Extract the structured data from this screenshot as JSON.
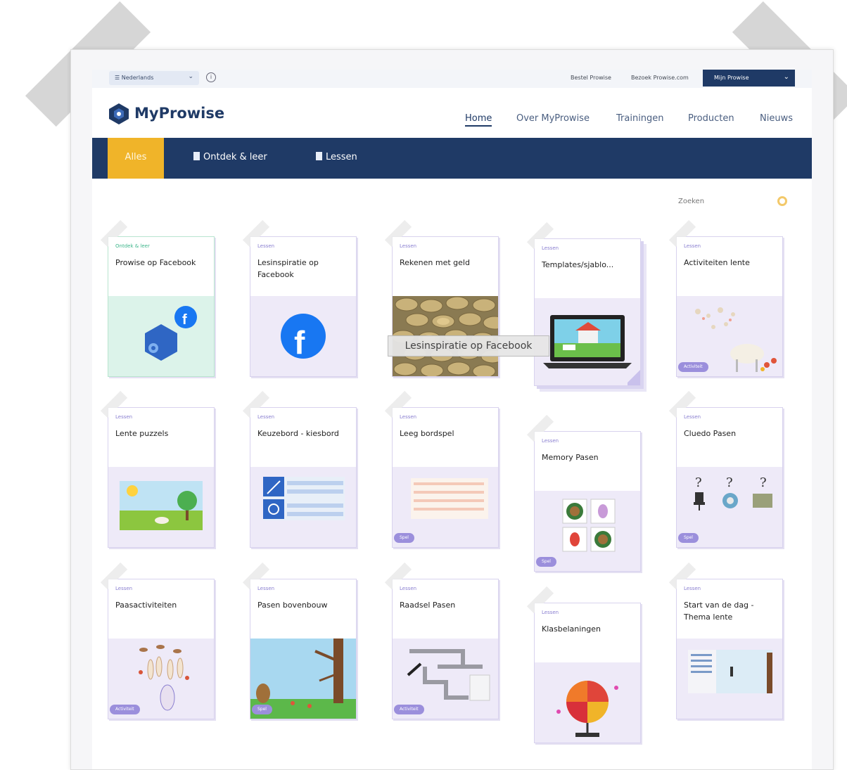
{
  "topbar": {
    "language": "Nederlands",
    "links": [
      "Bestel Prowise",
      "Bezoek Prowise.com"
    ],
    "account": "Mijn Prowise"
  },
  "brand": "MyProwise",
  "nav": [
    "Home",
    "Over MyProwise",
    "Trainingen",
    "Producten",
    "Nieuws"
  ],
  "filters": [
    "Alles",
    "Ontdek & leer",
    "Lessen"
  ],
  "search": {
    "label": "Zoeken"
  },
  "tooltip": "Lesinspiratie op Facebook",
  "cards": [
    {
      "category": "Ontdek & leer",
      "title": "Prowise op Facebook",
      "badge": ""
    },
    {
      "category": "Lessen",
      "title": "Lesinspiratie op Facebook",
      "badge": ""
    },
    {
      "category": "Lessen",
      "title": "Rekenen met geld",
      "badge": ""
    },
    {
      "category": "Lessen",
      "title": "Templates/sjablo...",
      "badge": ""
    },
    {
      "category": "Lessen",
      "title": "Activiteiten lente",
      "badge": "Activiteit"
    },
    {
      "category": "Lessen",
      "title": "Lente puzzels",
      "badge": ""
    },
    {
      "category": "Lessen",
      "title": "Keuzebord - kiesbord",
      "badge": ""
    },
    {
      "category": "Lessen",
      "title": "Leeg bordspel",
      "badge": "Spel"
    },
    {
      "category": "Lessen",
      "title": "Memory Pasen",
      "badge": "Spel"
    },
    {
      "category": "Lessen",
      "title": "Cluedo Pasen",
      "badge": "Spel"
    },
    {
      "category": "Lessen",
      "title": "Paasactiviteiten",
      "badge": "Activiteit"
    },
    {
      "category": "Lessen",
      "title": "Pasen bovenbouw",
      "badge": "Spel"
    },
    {
      "category": "Lessen",
      "title": "Raadsel Pasen",
      "badge": "Activiteit"
    },
    {
      "category": "Lessen",
      "title": "Klasbelaningen",
      "badge": ""
    },
    {
      "category": "Lessen",
      "title": "Start van de dag - Thema lente",
      "badge": ""
    }
  ],
  "colors": {
    "navy": "#1f3a66",
    "accent": "#f0b429",
    "lilac": "#eeeaf8",
    "green": "#dcf3ea"
  }
}
